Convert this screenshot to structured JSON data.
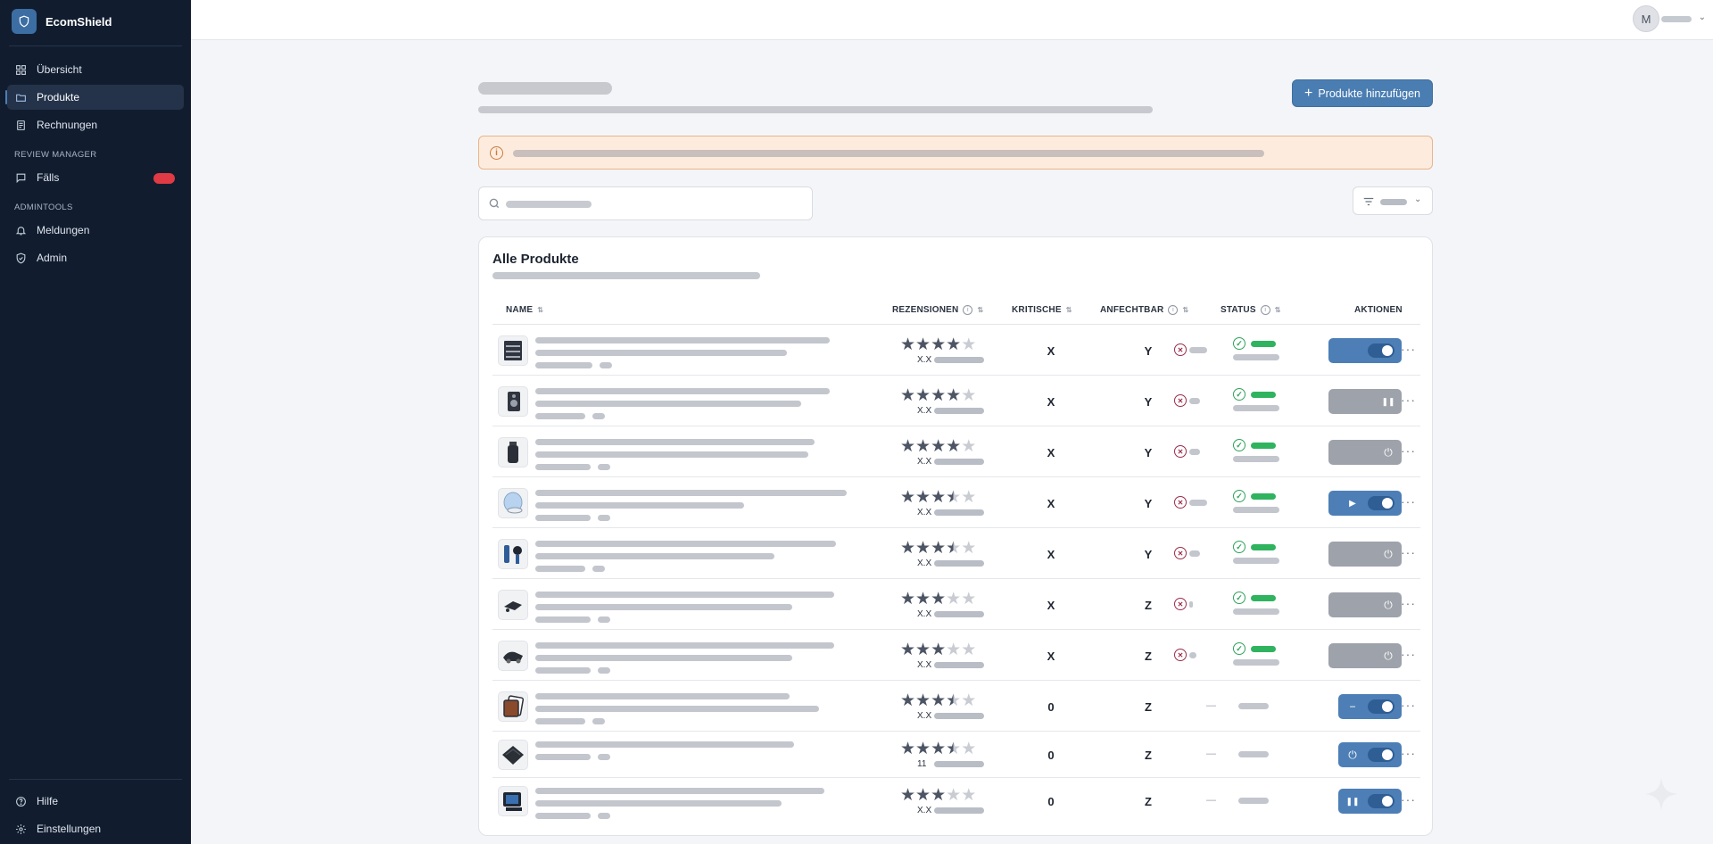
{
  "brand": {
    "name": "EcomShield"
  },
  "sidebar": {
    "items": [
      {
        "label": "Übersicht",
        "icon": "grid-icon"
      },
      {
        "label": "Produkte",
        "icon": "folder-icon",
        "active": true
      },
      {
        "label": "Rechnungen",
        "icon": "invoice-icon"
      }
    ],
    "review_section": "REVIEW MANAGER",
    "review_items": [
      {
        "label": "Fälls",
        "icon": "chat-icon",
        "badge_color": "#e03a44"
      }
    ],
    "admin_section": "ADMINTOOLS",
    "admin_items": [
      {
        "label": "Meldungen",
        "icon": "bell-icon"
      },
      {
        "label": "Admin",
        "icon": "shield-check-icon"
      }
    ],
    "bottom_items": [
      {
        "label": "Hilfe",
        "icon": "help-icon"
      },
      {
        "label": "Einstellungen",
        "icon": "gear-icon"
      }
    ]
  },
  "user": {
    "initial": "M"
  },
  "toolbar": {
    "add_label": "Produkte hinzufügen"
  },
  "card": {
    "title": "Alle Produkte"
  },
  "table": {
    "headers": {
      "name": "NAME",
      "reviews": "REZENSIONEN",
      "critical": "KRITISCHE",
      "contestable": "ANFECHTBAR",
      "status": "STATUS",
      "actions": "AKTIONEN"
    },
    "rows": [
      {
        "rating": "X.X",
        "stars": 4,
        "critical": "X",
        "contestable": "Y",
        "status": "ok",
        "action": "toggle-on",
        "product_icon": "shelf-icon"
      },
      {
        "rating": "X.X",
        "stars": 4,
        "critical": "X",
        "contestable": "Y",
        "status": "ok",
        "action": "pause",
        "product_icon": "speaker-icon"
      },
      {
        "rating": "X.X",
        "stars": 4,
        "critical": "X",
        "contestable": "Y",
        "status": "ok",
        "action": "power",
        "product_icon": "bottle-icon"
      },
      {
        "rating": "X.X",
        "stars": 3.5,
        "critical": "X",
        "contestable": "Y",
        "status": "ok",
        "action": "play-toggle",
        "product_icon": "mirror-icon"
      },
      {
        "rating": "X.X",
        "stars": 3.5,
        "critical": "X",
        "contestable": "Y",
        "status": "ok",
        "action": "power",
        "product_icon": "tools-icon"
      },
      {
        "rating": "X.X",
        "stars": 3,
        "critical": "X",
        "contestable": "Z",
        "status": "ok",
        "action": "power",
        "product_icon": "drone-icon"
      },
      {
        "rating": "X.X",
        "stars": 3,
        "critical": "X",
        "contestable": "Z",
        "status": "ok",
        "action": "power",
        "product_icon": "car-icon"
      },
      {
        "rating": "X.X",
        "stars": 3.5,
        "critical": "0",
        "contestable": "Z",
        "status": "none",
        "action": "minus-toggle",
        "product_icon": "cards-icon"
      },
      {
        "rating": "11",
        "stars": 3.5,
        "critical": "0",
        "contestable": "Z",
        "status": "none",
        "action": "power-toggle",
        "product_icon": "wallet-icon"
      },
      {
        "rating": "X.X",
        "stars": 3,
        "critical": "0",
        "contestable": "Z",
        "status": "none",
        "action": "pause-toggle",
        "product_icon": "monitor-icon"
      }
    ]
  },
  "colors": {
    "sidebar": "#111d2f",
    "accent": "#4a7db2",
    "alert_bg": "#fdecde",
    "success": "#2fb35f",
    "danger": "#9b2c4b"
  }
}
